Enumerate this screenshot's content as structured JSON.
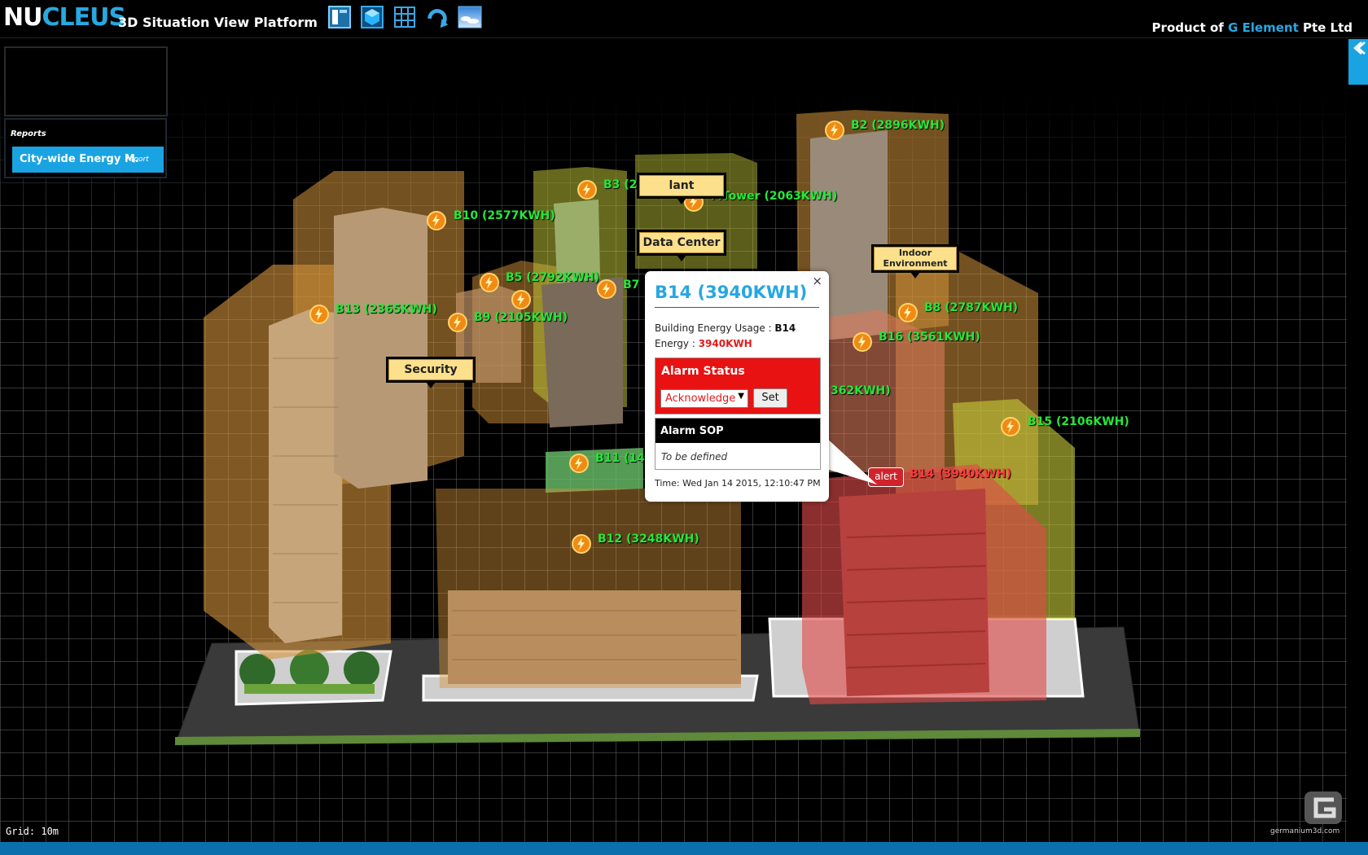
{
  "header": {
    "logo_nu": "NU",
    "logo_cleus": "CLEUS",
    "subtitle": "3D Situation View Platform",
    "product_prefix": "Product of ",
    "product_company": "G Element",
    "product_suffix": " Pte Ltd",
    "toolbar": [
      "layout-panel-icon",
      "3d-cube-icon",
      "grid-icon",
      "refresh-icon",
      "sky-view-icon"
    ]
  },
  "reports": {
    "heading": "Reports",
    "item_label": "City-wide Energy M.",
    "item_link": "report"
  },
  "scene": {
    "grid_label": "Grid: 10m",
    "brand_text": "germanium3d.com",
    "buildings": [
      {
        "label": "B2 (2896KWH)",
        "status": "normal"
      },
      {
        "label": "B3 (2117KWH)",
        "status": "normal"
      },
      {
        "label": "MTower (2063KWH)",
        "status": "normal"
      },
      {
        "label": "B10 (2577KWH)",
        "status": "normal"
      },
      {
        "label": "B5 (2792KWH)",
        "status": "normal"
      },
      {
        "label": "B7",
        "status": "normal"
      },
      {
        "label": "B13 (2365KWH)",
        "status": "normal"
      },
      {
        "label": "B9 (2105KWH)",
        "status": "normal"
      },
      {
        "label": "B8 (2787KWH)",
        "status": "normal"
      },
      {
        "label": "B16 (3561KWH)",
        "status": "normal"
      },
      {
        "label": "362KWH)",
        "status": "normal"
      },
      {
        "label": "B15 (2106KWH)",
        "status": "normal"
      },
      {
        "label": "B11 (14",
        "status": "normal"
      },
      {
        "label": "B14 (3940KWH)",
        "status": "alert"
      },
      {
        "label": "B12 (3248KWH)",
        "status": "normal"
      }
    ],
    "tags": {
      "plant": "lant",
      "datacenter": "Data Center",
      "indoor": "Indoor Environment",
      "security": "Security"
    },
    "alert_button": "alert"
  },
  "popup": {
    "title": "B14 (3940KWH)",
    "close": "×",
    "usage_label": "Building Energy Usage : ",
    "usage_value": "B14",
    "energy_label": "Energy : ",
    "energy_value": "3940KWH",
    "alarm_heading": "Alarm Status",
    "alarm_select_value": "Acknowledge",
    "set_button": "Set",
    "sop_heading": "Alarm SOP",
    "sop_body": "To be defined",
    "time": "Time: Wed Jan 14 2015, 12:10:47 PM"
  },
  "colors": {
    "accent": "#1aa3e2",
    "label_green": "#24e83a",
    "alert_red": "#e81212",
    "tag_yellow": "#fde08c"
  }
}
